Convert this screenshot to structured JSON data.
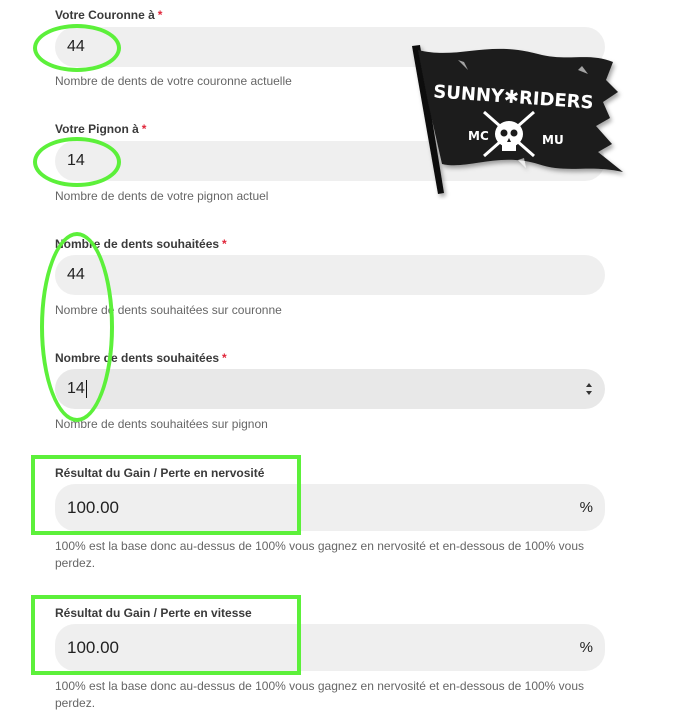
{
  "fields": [
    {
      "label": "Votre Couronne à",
      "required": "*",
      "value": "44",
      "help": "Nombre de dents de votre couronne actuelle"
    },
    {
      "label": "Votre Pignon à",
      "required": "*",
      "value": "14",
      "help": "Nombre de dents de votre pignon actuel"
    },
    {
      "label": "Nombre de dents souhaitées",
      "required": "*",
      "value": "44",
      "help": "Nombre de dents souhaitées sur couronne"
    },
    {
      "label": "Nombre de dents souhaitées",
      "required": "*",
      "value": "14",
      "help": "Nombre de dents souhaitées sur pignon"
    }
  ],
  "results": [
    {
      "label": "Résultat du Gain / Perte en nervosité",
      "value": "100.00",
      "unit": "%",
      "help": "100% est la base donc au-dessus de 100% vous gagnez en nervosité et en-dessous de 100% vous perdez."
    },
    {
      "label": "Résultat du Gain / Perte en vitesse",
      "value": "100.00",
      "unit": "%",
      "help": "100% est la base donc au-dessus de 100% vous gagnez en nervosité et en-dessous de 100% vous perdez."
    }
  ],
  "logo": {
    "brand": "SUNNY✱RIDERS",
    "left": "MC",
    "right": "MU"
  },
  "colors": {
    "highlight": "#5cf03a",
    "required": "#e0263a",
    "field_bg": "#efefef"
  }
}
